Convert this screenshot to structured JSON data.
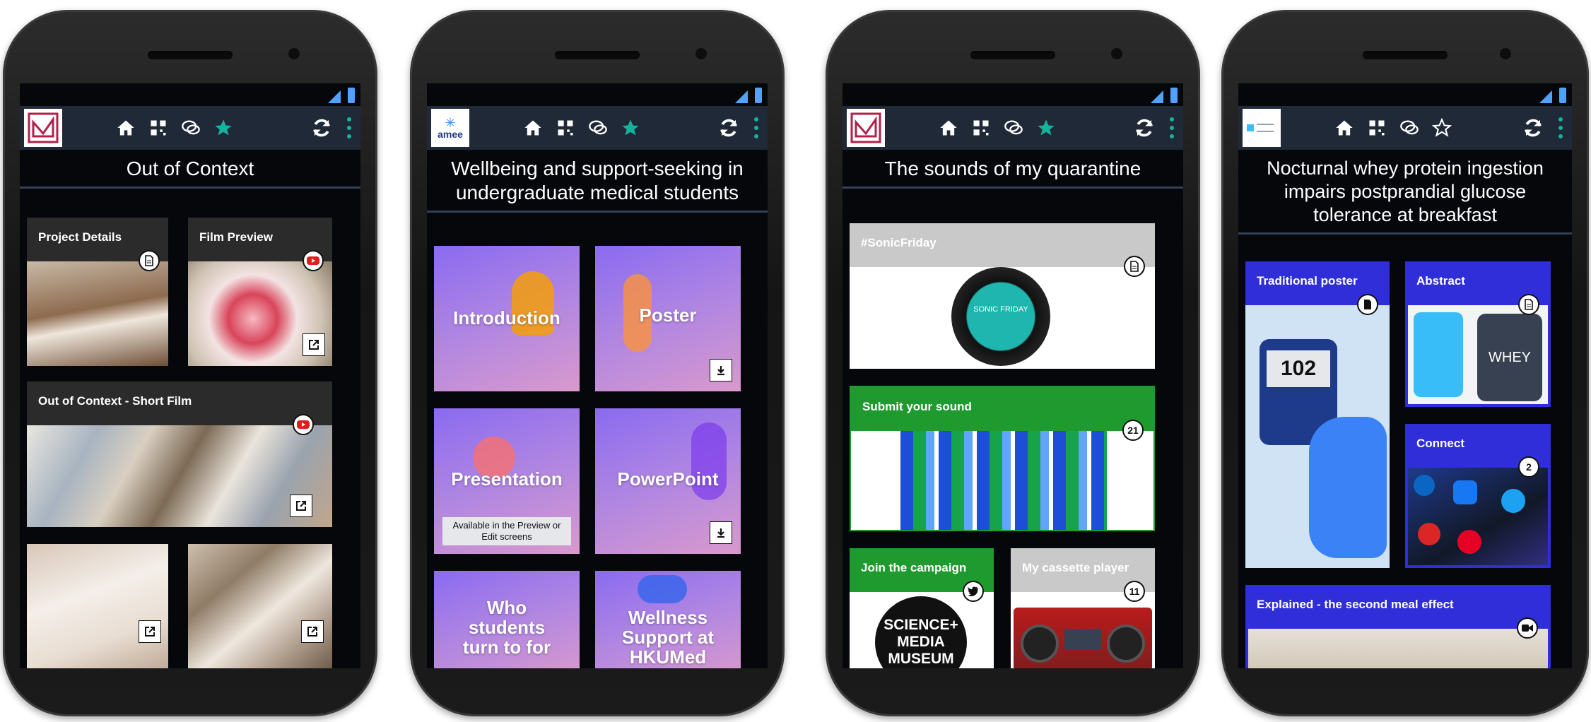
{
  "colors": {
    "toolbar": "#1f2937",
    "accent": "#16b39c",
    "tile_blue": "#2f2ed8",
    "tile_green": "#1f9a2e",
    "tile_grey": "#c9c9c9",
    "tile_dark": "#2b2b2b"
  },
  "toolbar_icons": [
    "home-icon",
    "grid-icon",
    "chat-icon",
    "star-icon",
    "refresh-icon",
    "more-vertical-icon"
  ],
  "phones": [
    {
      "title": "Out of Context",
      "logo": "curve-logo",
      "star_filled": true,
      "tiles": [
        {
          "label": "Project Details",
          "badge_icon": "document-icon"
        },
        {
          "label": "Film Preview",
          "badge_icon": "youtube-icon",
          "action_icon": "external-link-icon"
        },
        {
          "label": "Out of Context - Short Film",
          "badge_icon": "youtube-icon",
          "action_icon": "external-link-icon"
        },
        {
          "label": "",
          "action_icon": "external-link-icon"
        },
        {
          "label": "",
          "action_icon": "external-link-icon"
        }
      ]
    },
    {
      "title": "Wellbeing and support-seeking in undergraduate medical students",
      "logo_text": "amee",
      "star_filled": true,
      "tiles": [
        {
          "label": "Introduction"
        },
        {
          "label": "Poster",
          "action_icon": "download-icon"
        },
        {
          "label": "Presentation",
          "note": "Available in the Preview or Edit screens"
        },
        {
          "label": "PowerPoint",
          "action_icon": "download-icon"
        },
        {
          "label": "Who students turn to for"
        },
        {
          "label": "Wellness Support at HKUMed"
        }
      ]
    },
    {
      "title": "The sounds of my quarantine",
      "logo": "curve-logo",
      "star_filled": true,
      "tiles": [
        {
          "label": "#SonicFriday",
          "badge_icon": "document-icon",
          "disc_text": "SONIC FRIDAY"
        },
        {
          "label": "Submit your sound",
          "badge": "21"
        },
        {
          "label": "Join the campaign",
          "badge_icon": "twitter-icon",
          "image_text": "SCIENCE+ MEDIA MUSEUM"
        },
        {
          "label": "My cassette player",
          "badge": "11"
        }
      ]
    },
    {
      "title": "Nocturnal whey protein ingestion impairs postprandial glucose tolerance at breakfast",
      "logo": "society-logo",
      "star_filled": false,
      "tiles": [
        {
          "label": "Traditional poster",
          "badge_icon": "document-icon",
          "image_text": "102"
        },
        {
          "label": "Abstract",
          "badge_icon": "document-icon",
          "image_text": "WHEY"
        },
        {
          "label": "Connect",
          "badge": "2"
        },
        {
          "label": "Explained - the second meal effect",
          "badge_icon": "video-icon"
        }
      ]
    }
  ]
}
